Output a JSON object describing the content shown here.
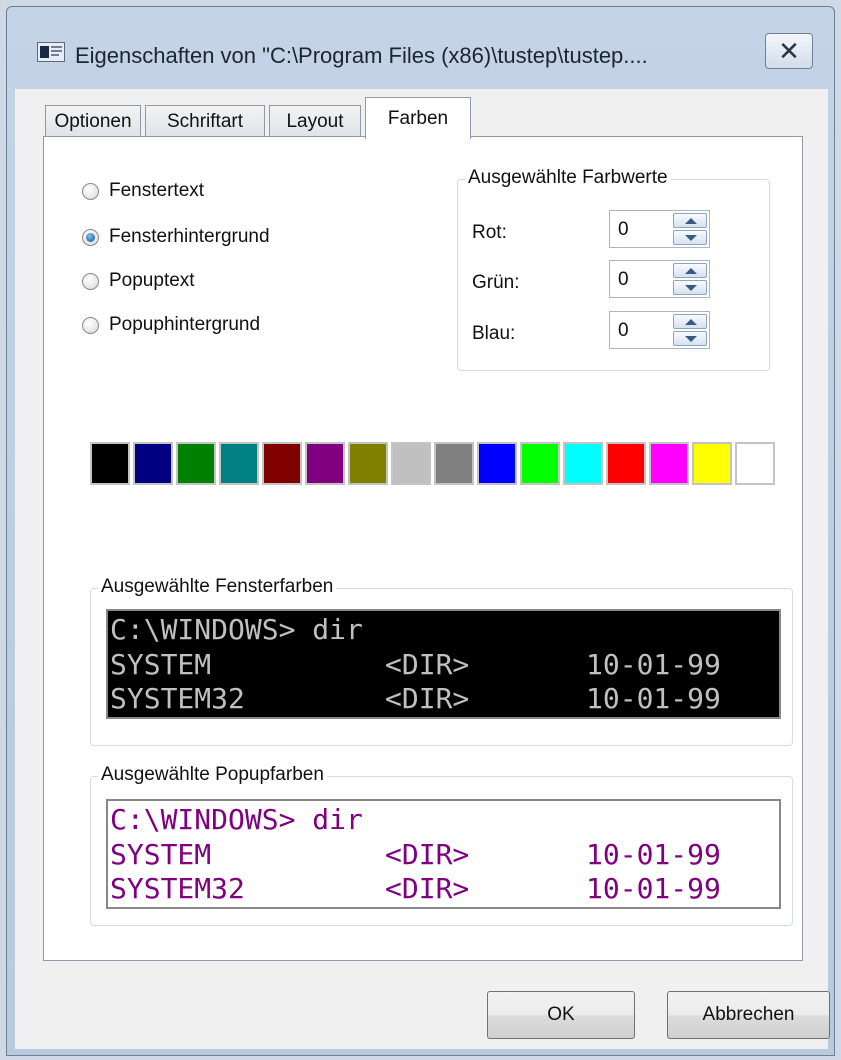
{
  "window": {
    "title": "Eigenschaften von \"C:\\Program Files (x86)\\tustep\\tustep....",
    "close_glyph": "✕"
  },
  "tabs": [
    {
      "label": "Optionen"
    },
    {
      "label": "Schriftart"
    },
    {
      "label": "Layout"
    },
    {
      "label": "Farben",
      "active": true
    }
  ],
  "color_targets": [
    {
      "label": "Fenstertext",
      "selected": false
    },
    {
      "label": "Fensterhintergrund",
      "selected": true
    },
    {
      "label": "Popuptext",
      "selected": false
    },
    {
      "label": "Popuphintergrund",
      "selected": false
    }
  ],
  "selected_values": {
    "legend": "Ausgewählte Farbwerte",
    "red": {
      "label": "Rot:",
      "value": "0"
    },
    "green": {
      "label": "Grün:",
      "value": "0"
    },
    "blue": {
      "label": "Blau:",
      "value": "0"
    }
  },
  "palette": [
    "#000000",
    "#000080",
    "#008000",
    "#008080",
    "#800000",
    "#800080",
    "#808000",
    "#c0c0c0",
    "#808080",
    "#0000ff",
    "#00ff00",
    "#00ffff",
    "#ff0000",
    "#ff00ff",
    "#ffff00",
    "#ffffff"
  ],
  "window_colors": {
    "legend": "Ausgewählte Fensterfarben",
    "background": "#000000",
    "text_color": "#c0c0c0",
    "prompt": "C:\\WINDOWS> dir",
    "rows": [
      {
        "name": "SYSTEM",
        "type": "<DIR>",
        "date": "10-01-99"
      },
      {
        "name": "SYSTEM32",
        "type": "<DIR>",
        "date": "10-01-99"
      }
    ]
  },
  "popup_colors": {
    "legend": "Ausgewählte Popupfarben",
    "background": "#ffffff",
    "text_color": "#800080",
    "prompt": "C:\\WINDOWS> dir",
    "rows": [
      {
        "name": "SYSTEM",
        "type": "<DIR>",
        "date": "10-01-99"
      },
      {
        "name": "SYSTEM32",
        "type": "<DIR>",
        "date": "10-01-99"
      }
    ]
  },
  "buttons": {
    "ok": "OK",
    "cancel": "Abbrechen"
  }
}
